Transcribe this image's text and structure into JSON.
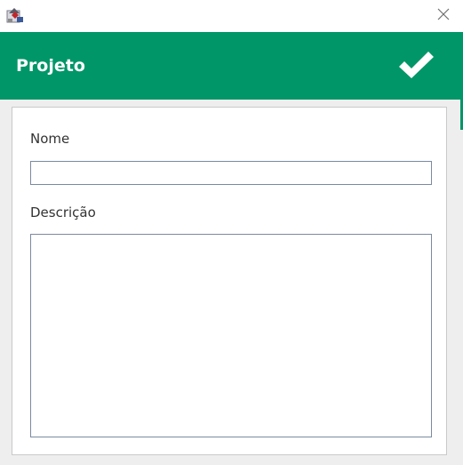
{
  "window": {
    "app_icon": "java-app-icon",
    "close_icon": "close-icon"
  },
  "header": {
    "title": "Projeto",
    "confirm_icon": "checkmark-icon",
    "background_color": "#009668"
  },
  "form": {
    "nome_label": "Nome",
    "nome_value": "",
    "descricao_label": "Descrição",
    "descricao_value": ""
  }
}
